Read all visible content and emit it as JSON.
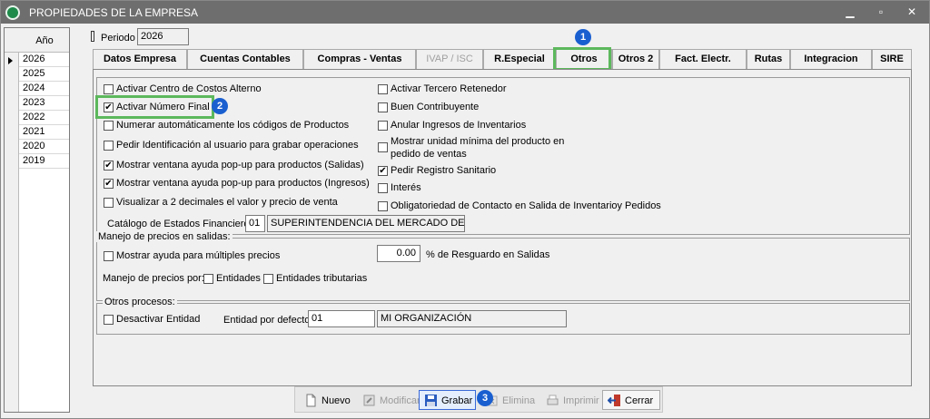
{
  "window": {
    "title": "PROPIEDADES DE LA EMPRESA",
    "minimize": "▁",
    "maximize": "▫",
    "close": "✕"
  },
  "year_panel": {
    "header": "Año",
    "years": [
      "2026",
      "2025",
      "2024",
      "2023",
      "2022",
      "2021",
      "2020",
      "2019"
    ],
    "selected": "2026"
  },
  "periodo": {
    "label": "Periodo",
    "value": "2026"
  },
  "tabs": [
    {
      "label": "Datos Empresa",
      "state": "normal"
    },
    {
      "label": "Cuentas Contables",
      "state": "normal"
    },
    {
      "label": "Compras - Ventas",
      "state": "normal"
    },
    {
      "label": "IVAP / ISC",
      "state": "disabled"
    },
    {
      "label": "R.Especial",
      "state": "normal"
    },
    {
      "label": "Otros",
      "state": "active"
    },
    {
      "label": "Otros 2",
      "state": "normal"
    },
    {
      "label": "Fact. Electr.",
      "state": "normal"
    },
    {
      "label": "Rutas",
      "state": "normal"
    },
    {
      "label": "Integracion",
      "state": "normal"
    },
    {
      "label": "SIRE",
      "state": "normal"
    }
  ],
  "left_options": [
    {
      "label": "Activar Centro de Costos Alterno",
      "checked": false
    },
    {
      "label": "Activar Número Final",
      "checked": true
    },
    {
      "label": "Numerar automáticamente los códigos de Productos",
      "checked": false
    },
    {
      "label": "Pedir Identificación al usuario para grabar operaciones",
      "checked": false
    },
    {
      "label": "Mostrar ventana ayuda pop-up para productos (Salidas)",
      "checked": true
    },
    {
      "label": "Mostrar ventana ayuda pop-up para productos (Ingresos)",
      "checked": true
    },
    {
      "label": "Visualizar a 2 decimales el valor y precio de venta",
      "checked": false
    }
  ],
  "right_options": [
    {
      "label": "Activar Tercero Retenedor",
      "checked": false
    },
    {
      "label": "Buen Contribuyente",
      "checked": false
    },
    {
      "label": "Anular Ingresos de Inventarios",
      "checked": false
    },
    {
      "label_line1": "Mostrar unidad mínima del producto en",
      "label_line2": "pedido de ventas",
      "checked": false
    },
    {
      "label": "Pedir Registro Sanitario",
      "checked": true
    },
    {
      "label": "Interés",
      "checked": false
    },
    {
      "label": "Obligatoriedad de Contacto en Salida de  Inventarioy Pedidos",
      "checked": false
    }
  ],
  "catalogo": {
    "label": "Catálogo de Estados Financieros",
    "code": "01",
    "name": "SUPERINTENDENCIA DEL MERCADO DE VALORES"
  },
  "precios": {
    "title": "Manejo de precios en salidas:",
    "ayuda_label": "Mostrar ayuda para múltiples precios",
    "ayuda_checked": false,
    "resguardo_value": "0.00",
    "resguardo_label": "%  de Resguardo en Salidas",
    "manejo_label": "Manejo de precios por:",
    "entidades_label": "Entidades",
    "entidades_trib_label": "Entidades tributarias"
  },
  "otros_procesos": {
    "title": "Otros procesos:",
    "desactivar_label": "Desactivar Entidad",
    "entidad_label": "Entidad por defecto",
    "entidad_code": "01",
    "entidad_name": "MI ORGANIZACIÓN"
  },
  "buttons": {
    "nuevo": "Nuevo",
    "modificar": "Modificar",
    "grabar": "Grabar",
    "elimina": "Elimina",
    "imprimir": "Imprimir",
    "cerrar": "Cerrar"
  },
  "badges": [
    "1",
    "2",
    "3"
  ],
  "colors": {
    "highlight": "#5cb85c",
    "badge": "#1a5fd0",
    "titlebar": "#6e6e6e"
  }
}
